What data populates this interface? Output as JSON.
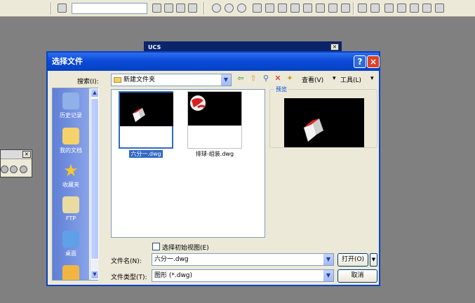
{
  "ucs_window": {
    "title": "UCS",
    "close_glyph": "×"
  },
  "palette": {
    "close_glyph": "×"
  },
  "dialog": {
    "title": "选择文件",
    "help_glyph": "?",
    "close_glyph": "×",
    "search_label": "搜索(I):",
    "current_folder": "新建文件夹",
    "view_label": "查看(V)",
    "tools_label": "工具(L)",
    "places": [
      {
        "label": "历史记录",
        "icon": "history-icon",
        "color": "#8fb0e8"
      },
      {
        "label": "我的文档",
        "icon": "my-documents-icon",
        "color": "#f5d36a"
      },
      {
        "label": "收藏夹",
        "icon": "favorites-icon",
        "color": "#f6c633"
      },
      {
        "label": "FTP",
        "icon": "ftp-icon",
        "color": "#e8dca0"
      },
      {
        "label": "桌面",
        "icon": "desktop-icon",
        "color": "#5fa0e8"
      },
      {
        "label": "",
        "icon": "folder-icon",
        "color": "#f2b640"
      }
    ],
    "files": [
      {
        "name": "六分一.dwg",
        "selected": true
      },
      {
        "name": "排球-组装.dwg",
        "selected": false
      }
    ],
    "preview_label": "预览",
    "initial_view_label": "选择初始视图(E)",
    "filename_label": "文件名(N):",
    "filename_value": "六分一.dwg",
    "filetype_label": "文件类型(T):",
    "filetype_value": "图形 (*.dwg)",
    "open_label": "打开(O)",
    "cancel_label": "取消"
  },
  "colors": {
    "title_blue": "#0a4ad8",
    "selection": "#316ac5",
    "desktop": "#808080"
  }
}
